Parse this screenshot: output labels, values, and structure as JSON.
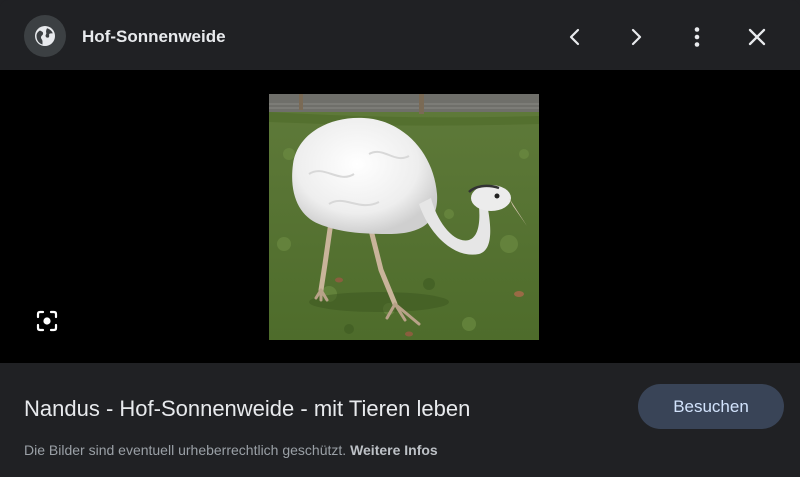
{
  "header": {
    "site_name": "Hof-Sonnenweide",
    "icons": {
      "site": "globe-icon",
      "prev": "chevron-left-icon",
      "next": "chevron-right-icon",
      "more": "more-vert-icon",
      "close": "close-icon"
    }
  },
  "image": {
    "subject": "rhea-photo",
    "lens_icon": "google-lens-icon"
  },
  "footer": {
    "title": "Nandus - Hof-Sonnenweide - mit Tieren leben",
    "visit_label": "Besuchen",
    "notice_text": "Die Bilder sind eventuell urheberrechtlich geschützt.",
    "more_info_label": "Weitere Infos"
  },
  "colors": {
    "background": "#202124",
    "stage": "#000000",
    "text_primary": "#e8eaed",
    "text_secondary": "#9aa0a6",
    "visit_button_bg": "#394457",
    "visit_button_text": "#d2e3fc"
  }
}
